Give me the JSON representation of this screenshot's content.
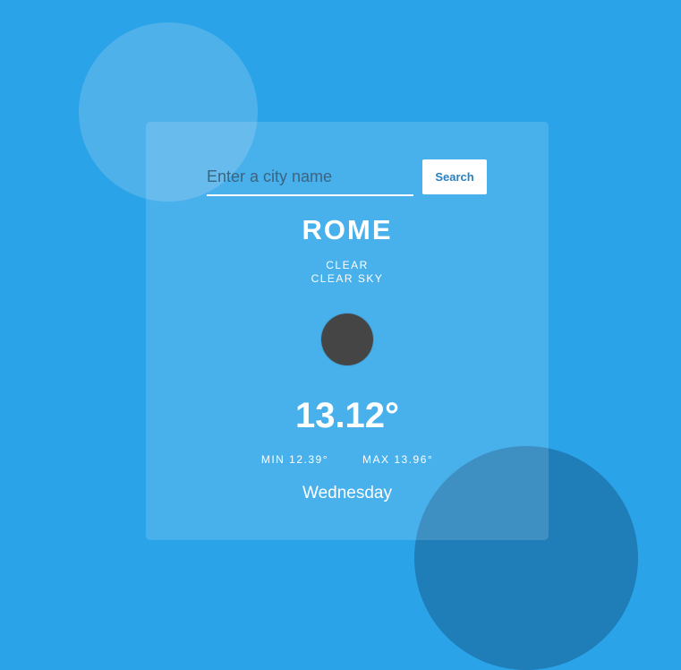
{
  "search": {
    "placeholder": "Enter a city name",
    "button_label": "Search"
  },
  "weather": {
    "city": "ROME",
    "main": "CLEAR",
    "description": "CLEAR SKY",
    "icon_name": "weather-status-icon",
    "temperature": "13.12°",
    "min": "MIN 12.39°",
    "max": "MAX 13.96°",
    "day": "Wednesday"
  },
  "colors": {
    "background": "#2ba3e8",
    "top_circle": "#4eb1ea",
    "bottom_circle": "#1f7db8",
    "card": "#48afeb",
    "button_text": "#2a7fbf",
    "icon_dark": "#454545",
    "text": "#ffffff"
  }
}
